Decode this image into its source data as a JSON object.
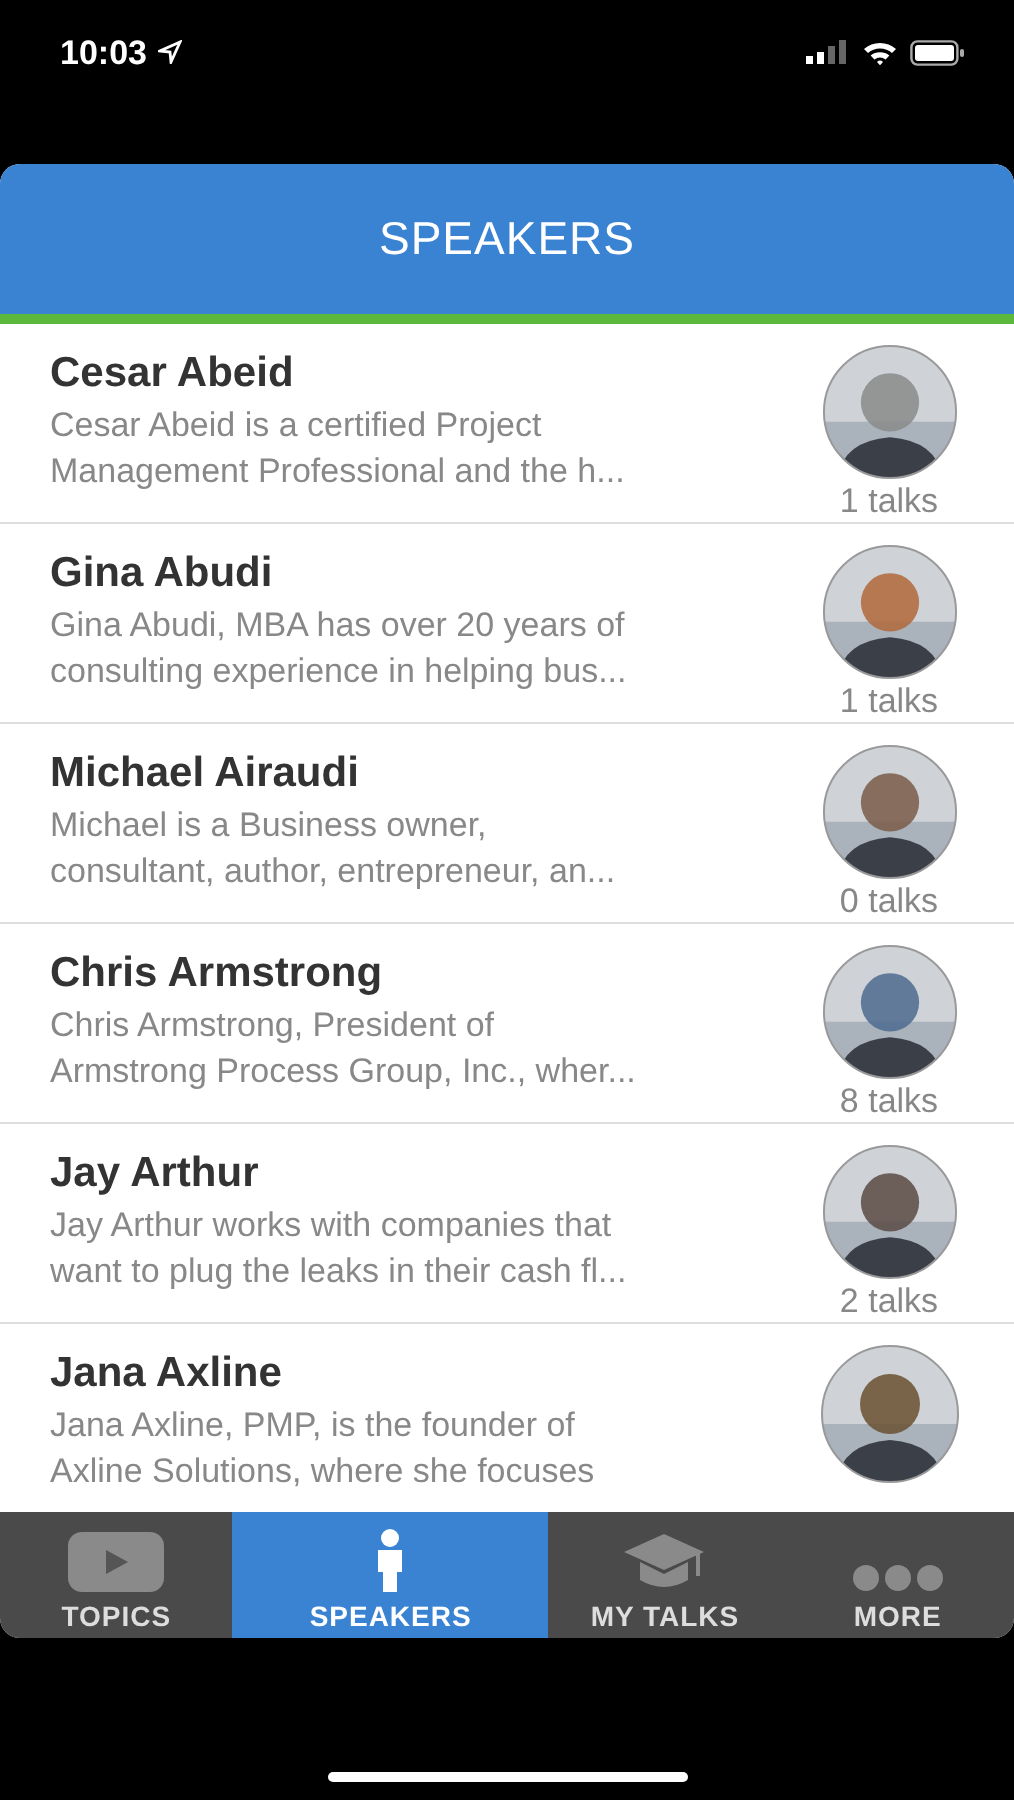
{
  "status_bar": {
    "time": "10:03"
  },
  "header": {
    "title": "SPEAKERS"
  },
  "speakers": [
    {
      "name": "Cesar Abeid",
      "description": [
        "Cesar Abeid is a certified Project",
        "Management Professional and the h..."
      ],
      "talks": "1 talks"
    },
    {
      "name": "Gina Abudi",
      "description": [
        "Gina Abudi, MBA has over 20 years of",
        "consulting experience in helping bus..."
      ],
      "talks": "1 talks"
    },
    {
      "name": "Michael Airaudi",
      "description": [
        "Michael is a Business owner,",
        "consultant, author, entrepreneur, an..."
      ],
      "talks": "0 talks"
    },
    {
      "name": "Chris Armstrong",
      "description": [
        "Chris Armstrong, President of",
        "Armstrong Process Group, Inc., wher..."
      ],
      "talks": "8 talks"
    },
    {
      "name": "Jay Arthur",
      "description": [
        "Jay Arthur works with companies that",
        "want to plug the leaks in their cash fl..."
      ],
      "talks": "2 talks"
    },
    {
      "name": "Jana Axline",
      "description": [
        "Jana Axline, PMP, is the founder of",
        "Axline Solutions, where she focuses"
      ]
    }
  ],
  "tab_bar": [
    {
      "label": "TOPICS",
      "kind": "play",
      "selected": false
    },
    {
      "label": "SPEAKERS",
      "kind": "person",
      "selected": true
    },
    {
      "label": "MY TALKS",
      "kind": "cap",
      "selected": false
    },
    {
      "label": "MORE",
      "kind": "dots",
      "selected": false
    }
  ]
}
